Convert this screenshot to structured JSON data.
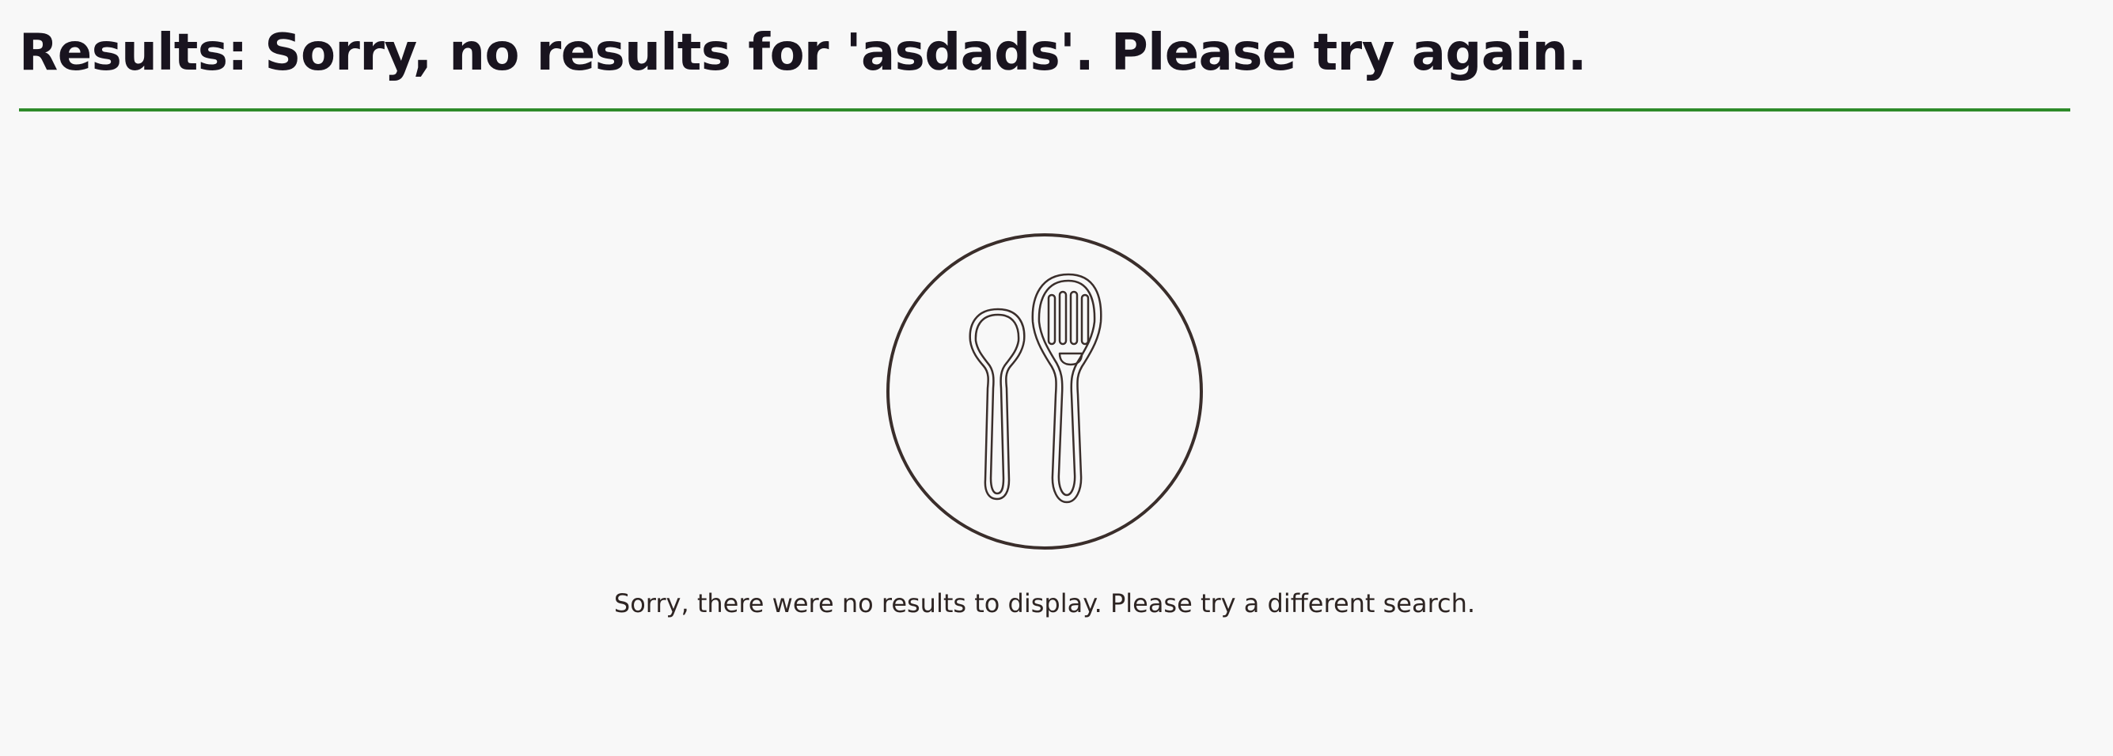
{
  "results": {
    "heading": "Results: Sorry, no results for 'asdads'. Please try again.",
    "message": "Sorry, there were no results to display. Please try a different search.",
    "illustration_icon": "spoon-and-slotted-spoon-icon"
  },
  "colors": {
    "background": "#f8f8f8",
    "heading_text": "#19141f",
    "accent_rule": "#2e8b2a",
    "icon_stroke": "#3a2e2b",
    "message_text": "#2e2523"
  }
}
